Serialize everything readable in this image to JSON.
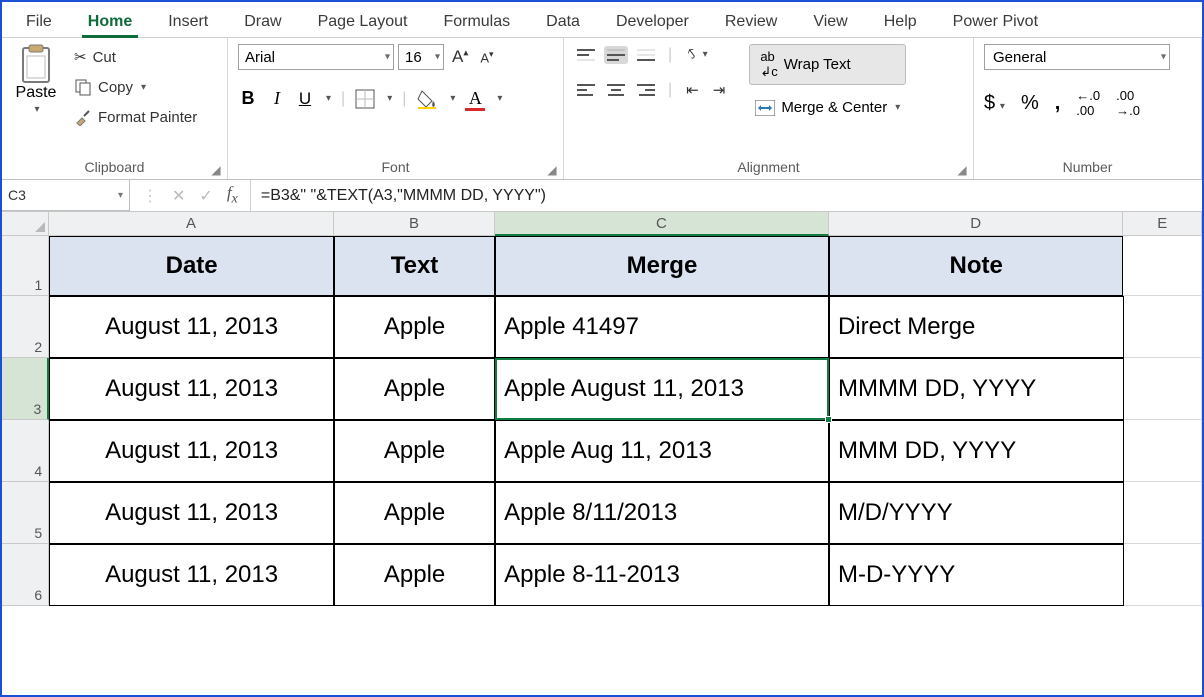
{
  "tabs": {
    "file": "File",
    "home": "Home",
    "insert": "Insert",
    "draw": "Draw",
    "pagelayout": "Page Layout",
    "formulas": "Formulas",
    "data": "Data",
    "developer": "Developer",
    "review": "Review",
    "view": "View",
    "help": "Help",
    "powerpivot": "Power Pivot"
  },
  "ribbon": {
    "clipboard": {
      "paste": "Paste",
      "cut": "Cut",
      "copy": "Copy",
      "format_painter": "Format Painter",
      "label": "Clipboard"
    },
    "font": {
      "name": "Arial",
      "size": "16",
      "label": "Font"
    },
    "alignment": {
      "wrap": "Wrap Text",
      "merge": "Merge & Center",
      "label": "Alignment"
    },
    "number": {
      "format": "General",
      "label": "Number"
    }
  },
  "namebox": "C3",
  "formula": "=B3&\" \"&TEXT(A3,\"MMMM DD, YYYY\")",
  "columns": {
    "A": "A",
    "B": "B",
    "C": "C",
    "D": "D",
    "E": "E"
  },
  "rows": [
    "1",
    "2",
    "3",
    "4",
    "5",
    "6"
  ],
  "table": {
    "headers": {
      "A": "Date",
      "B": "Text",
      "C": "Merge",
      "D": "Note"
    },
    "r2": {
      "A": "August 11, 2013",
      "B": "Apple",
      "C": "Apple 41497",
      "D": "Direct Merge"
    },
    "r3": {
      "A": "August 11, 2013",
      "B": "Apple",
      "C": "Apple August 11, 2013",
      "D": "MMMM DD, YYYY"
    },
    "r4": {
      "A": "August 11, 2013",
      "B": "Apple",
      "C": "Apple Aug 11, 2013",
      "D": "MMM DD, YYYY"
    },
    "r5": {
      "A": "August 11, 2013",
      "B": "Apple",
      "C": "Apple 8/11/2013",
      "D": "M/D/YYYY"
    },
    "r6": {
      "A": "August 11, 2013",
      "B": "Apple",
      "C": "Apple 8-11-2013",
      "D": "M-D-YYYY"
    }
  }
}
